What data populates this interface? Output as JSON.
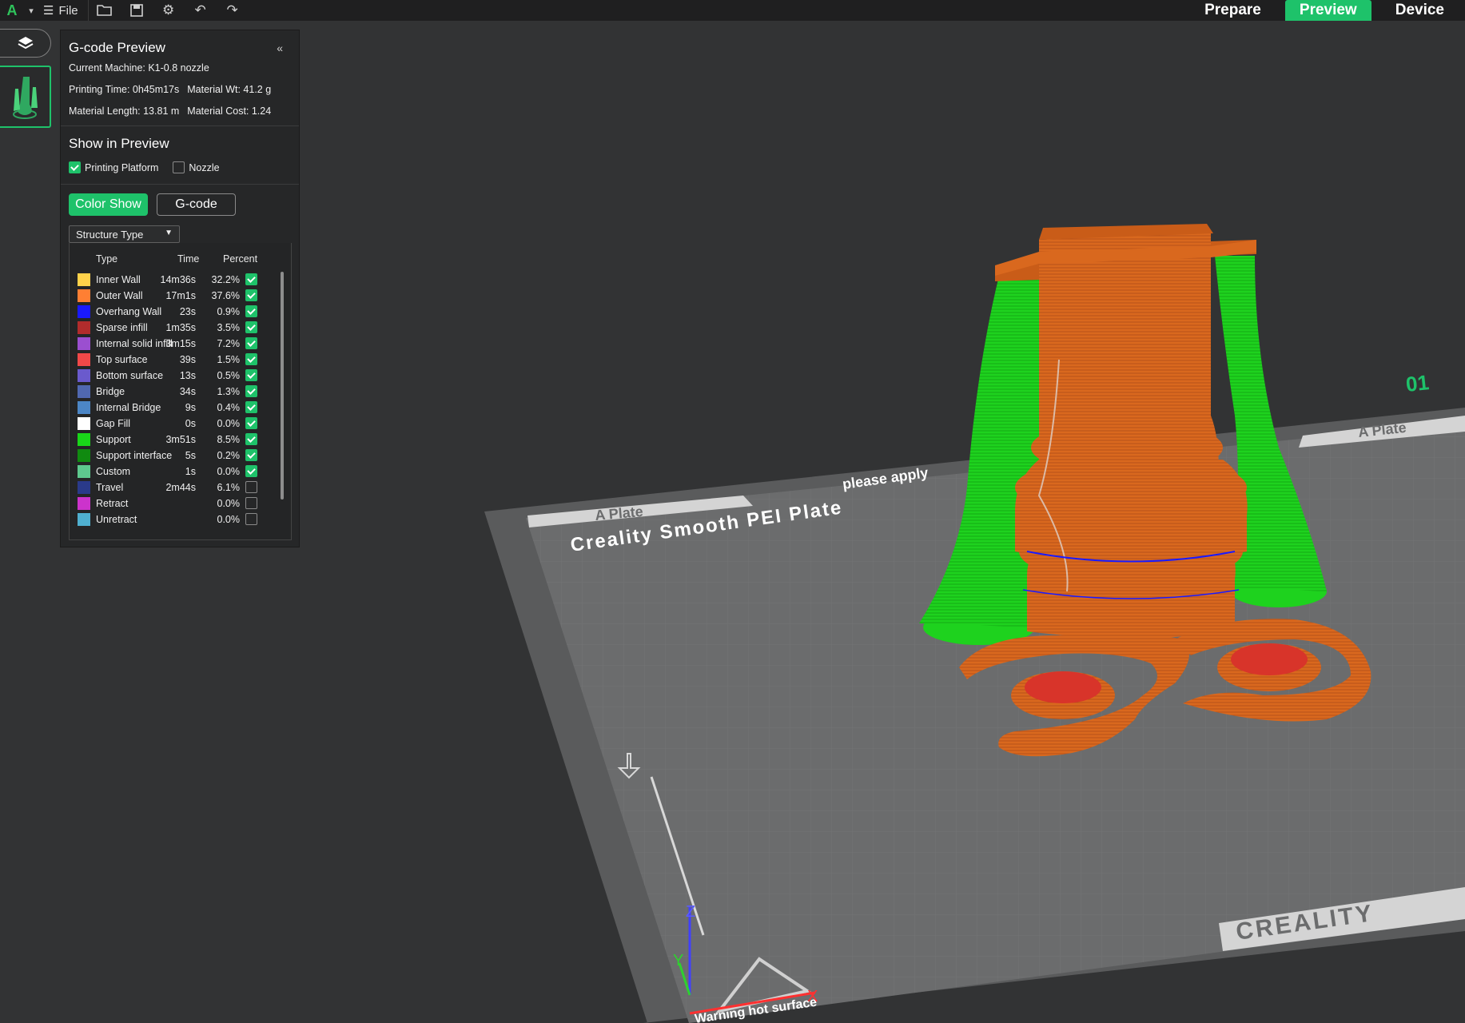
{
  "topbar": {
    "file_label": "File",
    "tabs": [
      {
        "label": "Prepare",
        "active": false
      },
      {
        "label": "Preview",
        "active": true
      },
      {
        "label": "Device",
        "active": false
      }
    ]
  },
  "panel": {
    "title": "G-code Preview",
    "collapse_glyph": "«",
    "machine": "Current Machine: K1-0.8 nozzle",
    "printing_time": "Printing Time: 0h45m17s",
    "material_wt": "Material Wt: 41.2 g",
    "material_length": "Material Length: 13.81 m",
    "material_cost": "Material Cost: 1.24",
    "show_in_preview": "Show in Preview",
    "printing_platform": {
      "label": "Printing Platform",
      "checked": true
    },
    "nozzle": {
      "label": "Nozzle",
      "checked": false
    },
    "color_show_label": "Color Show",
    "gcode_label": "G-code",
    "structure_type": "Structure Type"
  },
  "legend": {
    "headers": {
      "type": "Type",
      "time": "Time",
      "percent": "Percent"
    },
    "rows": [
      {
        "name": "Inner Wall",
        "time": "14m36s",
        "percent": "32.2%",
        "color": "#ffd24a",
        "checked": true
      },
      {
        "name": "Outer Wall",
        "time": "17m1s",
        "percent": "37.6%",
        "color": "#ff7f33",
        "checked": true
      },
      {
        "name": "Overhang Wall",
        "time": "23s",
        "percent": "0.9%",
        "color": "#1a1aff",
        "checked": true
      },
      {
        "name": "Sparse infill",
        "time": "1m35s",
        "percent": "3.5%",
        "color": "#b22c2c",
        "checked": true
      },
      {
        "name": "Internal solid infill",
        "time": "3m15s",
        "percent": "7.2%",
        "color": "#9b4fd0",
        "checked": true
      },
      {
        "name": "Top surface",
        "time": "39s",
        "percent": "1.5%",
        "color": "#f04848",
        "checked": true
      },
      {
        "name": "Bottom surface",
        "time": "13s",
        "percent": "0.5%",
        "color": "#6a5acd",
        "checked": true
      },
      {
        "name": "Bridge",
        "time": "34s",
        "percent": "1.3%",
        "color": "#5068b0",
        "checked": true
      },
      {
        "name": "Internal Bridge",
        "time": "9s",
        "percent": "0.4%",
        "color": "#4c86c6",
        "checked": true
      },
      {
        "name": "Gap Fill",
        "time": "0s",
        "percent": "0.0%",
        "color": "#ffffff",
        "checked": true
      },
      {
        "name": "Support",
        "time": "3m51s",
        "percent": "8.5%",
        "color": "#19d619",
        "checked": true
      },
      {
        "name": "Support interface",
        "time": "5s",
        "percent": "0.2%",
        "color": "#108a10",
        "checked": true
      },
      {
        "name": "Custom",
        "time": "1s",
        "percent": "0.0%",
        "color": "#5ec98e",
        "checked": true
      },
      {
        "name": "Travel",
        "time": "2m44s",
        "percent": "6.1%",
        "color": "#2a3a8a",
        "checked": false
      },
      {
        "name": "Retract",
        "time": "",
        "percent": "0.0%",
        "color": "#cc33cc",
        "checked": false
      },
      {
        "name": "Unretract",
        "time": "",
        "percent": "0.0%",
        "color": "#4fb0d0",
        "checked": false
      }
    ]
  },
  "plate": {
    "brand_text": "Creality Smooth PEI Plate",
    "plate_label": "A Plate",
    "plate_label_right": "A Plate",
    "apply_text": "please apply",
    "warning_text": "Warning hot surface",
    "logo_text": "CREALITY",
    "plate_number": "01",
    "axis_x": "X",
    "axis_y": "Y",
    "axis_z": "Z"
  },
  "colors": {
    "accent": "#1ec26a",
    "background": "#323334",
    "panel": "#262728"
  }
}
